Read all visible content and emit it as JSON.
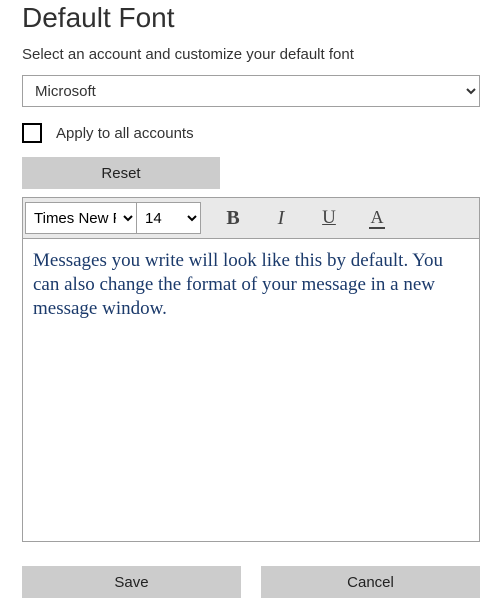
{
  "page": {
    "title": "Default Font",
    "subtitle": "Select an account and customize your default font"
  },
  "account": {
    "selected": "Microsoft"
  },
  "apply_all": {
    "label": "Apply to all accounts",
    "checked": false
  },
  "reset": {
    "label": "Reset"
  },
  "toolbar": {
    "font_family": "Times New R",
    "font_size": "14",
    "bold_title": "Bold",
    "italic_title": "Italic",
    "underline_title": "Underline",
    "fontcolor_title": "Font Color",
    "fontcolor_letter": "A"
  },
  "preview": {
    "text": "Messages you write will look like this by default. You can also change the format of your message in a new message window.",
    "color": "#1b3a6b"
  },
  "footer": {
    "save_label": "Save",
    "cancel_label": "Cancel"
  }
}
